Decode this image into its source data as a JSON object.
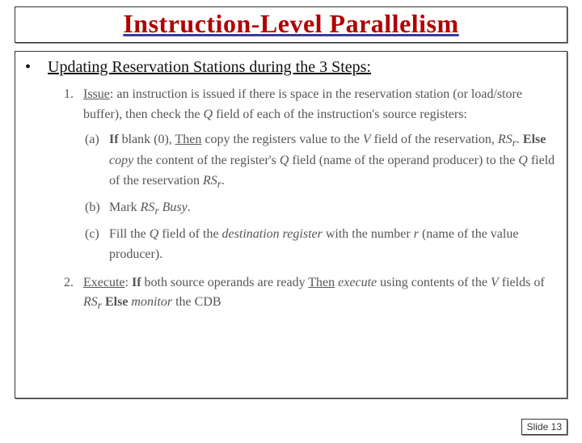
{
  "title": "Instruction-Level Parallelism",
  "bullet": {
    "marker": "•",
    "text": "Updating Reservation Stations during the 3 Steps:"
  },
  "items": [
    {
      "num": "1.",
      "label_u": "Issue",
      "rest": ": an instruction is issued if there is space in the reservation station (or load/store buffer), then check the ",
      "q1": "Q",
      "rest2": " field of each of the instruction's source registers:",
      "subs": [
        {
          "letter": "(a)",
          "parts": {
            "bold1": "If",
            "p1": " blank (0), ",
            "then": "Then",
            "p2": " copy the registers value to the ",
            "v": "V",
            "p3": " field of the reservation, ",
            "rs1": "RS",
            "sub_r1": "r",
            "p4": ". ",
            "else": "Else",
            "p5": " ",
            "copy": "copy",
            "p6": " the content of the register's ",
            "q2": "Q",
            "p7": " field (name of the operand producer) to the ",
            "q3": "Q",
            "p8": " field of the reservation ",
            "rs2": "RS",
            "sub_r2": "r",
            "p9": "."
          }
        },
        {
          "letter": "(b)",
          "text1": "Mark ",
          "rs": "RS",
          "sub_r": "r",
          "busy": " Busy",
          "dot": "."
        },
        {
          "letter": "(c)",
          "t1": "Fill the ",
          "q": "Q",
          "t2": " field of the ",
          "dest": "destination register",
          "t3": " with the number ",
          "r": "r",
          "t4": " (name of the value producer)."
        }
      ]
    },
    {
      "num": "2.",
      "label_u": "Execute",
      "p1": ": ",
      "if": "If",
      "p2": " both source operands are ready ",
      "then": "Then",
      "p3": " ",
      "exec": "execute",
      "p4": " using contents of the ",
      "v": "V",
      "p5": " fields of ",
      "rs": "RS",
      "sub_r": "r",
      "p6": " ",
      "else": "Else",
      "p7": " ",
      "mon": "monitor",
      "p8": " the CDB"
    }
  ],
  "pager": "Slide 13"
}
